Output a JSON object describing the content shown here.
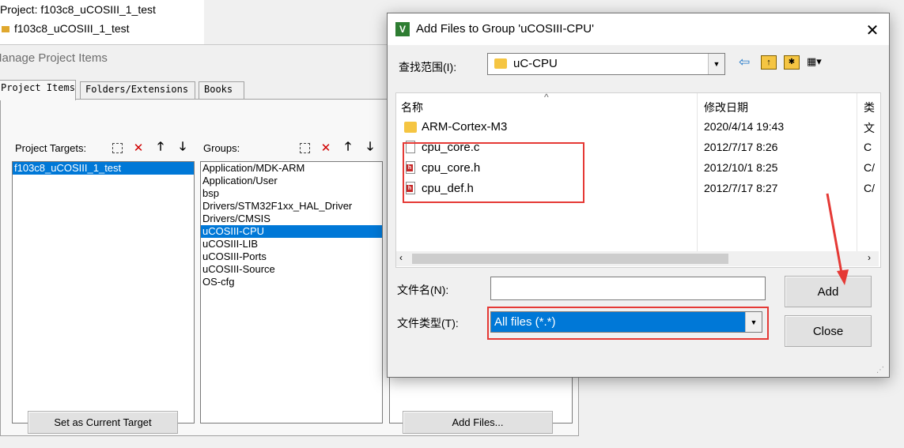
{
  "background": {
    "project_line": "Project: f103c8_uCOSIII_1_test",
    "target_line": "f103c8_uCOSIII_1_test"
  },
  "manage": {
    "title": "Manage Project Items",
    "tabs": [
      "Project Items",
      "Folders/Extensions",
      "Books"
    ],
    "targets_label": "Project Targets:",
    "targets": [
      "f103c8_uCOSIII_1_test"
    ],
    "groups_label": "Groups:",
    "groups": [
      "Application/MDK-ARM",
      "Application/User",
      "bsp",
      "Drivers/STM32F1xx_HAL_Driver",
      "Drivers/CMSIS",
      "uCOSIII-CPU",
      "uCOSIII-LIB",
      "uCOSIII-Ports",
      "uCOSIII-Source",
      "OS-cfg"
    ],
    "selected_group_index": 5,
    "set_current_target_label": "Set as Current Target",
    "add_files_label": "Add Files..."
  },
  "add_dialog": {
    "title": "Add Files to Group 'uCOSIII-CPU'",
    "look_in_label": "查找范围(I):",
    "look_in_value": "uC-CPU",
    "columns": {
      "name": "名称",
      "date": "修改日期",
      "type": "类"
    },
    "files": [
      {
        "name": "ARM-Cortex-M3",
        "date": "2020/4/14 19:43",
        "type": "文",
        "icon": "folder-icon"
      },
      {
        "name": "cpu_core.c",
        "date": "2012/7/17 8:26",
        "type": "C",
        "icon": "c-file-icon"
      },
      {
        "name": "cpu_core.h",
        "date": "2012/10/1 8:25",
        "type": "C/",
        "icon": "h-file-icon"
      },
      {
        "name": "cpu_def.h",
        "date": "2012/7/17 8:27",
        "type": "C/",
        "icon": "h-file-icon"
      }
    ],
    "filename_label": "文件名(N):",
    "filename_value": "",
    "filetype_label": "文件类型(T):",
    "filetype_value": "All files (*.*)",
    "add_label": "Add",
    "close_label": "Close"
  },
  "colors": {
    "selection": "#0078d7",
    "annotation": "#e53935",
    "folder": "#f5c542"
  }
}
